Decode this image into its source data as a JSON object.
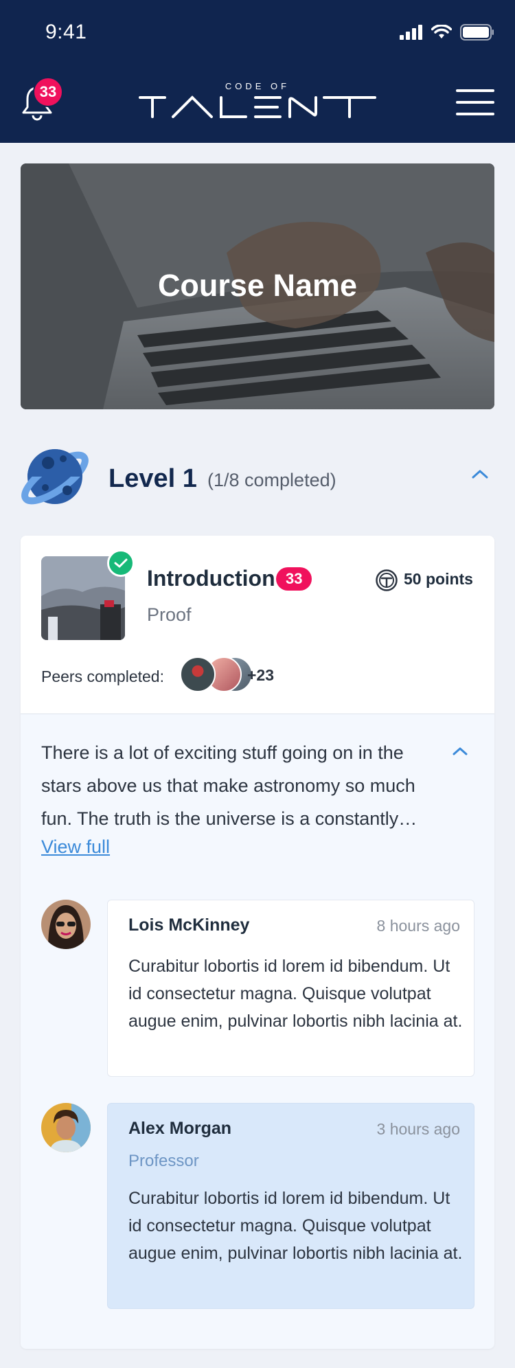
{
  "status_bar": {
    "time": "9:41"
  },
  "header": {
    "notification_count": "33",
    "logo_top": "CODE OF",
    "logo_main": "TALENT"
  },
  "hero": {
    "title": "Course Name"
  },
  "level": {
    "title": "Level 1",
    "progress": "(1/8 completed)"
  },
  "lesson": {
    "title": "Introduction",
    "badge": "33",
    "points": "50 points",
    "subtitle": "Proof",
    "peers_label": "Peers completed:",
    "peers_more": "+23",
    "description": "There is a lot of exciting stuff going on in the stars above us that make astronomy so much fun. The truth is the universe is a constantly…",
    "view_full": "View full"
  },
  "comments": [
    {
      "name": "Lois McKinney",
      "time": "8 hours ago",
      "role": "",
      "text": "Curabitur lobortis id lorem id bibendum. Ut id consectetur magna. Quisque volutpat augue enim, pulvinar lobortis nibh lacinia at."
    },
    {
      "name": "Alex Morgan",
      "time": "3 hours ago",
      "role": "Professor",
      "text": "Curabitur lobortis id lorem id bibendum. Ut id consectetur magna. Quisque volutpat augue enim, pulvinar lobortis nibh lacinia at."
    }
  ],
  "colors": {
    "header_bg": "#10254f",
    "badge": "#f0115c",
    "check": "#17b978",
    "link": "#3b8ad9",
    "professor_bg": "#d9e8fa"
  },
  "icons": {
    "notification": "bell-icon",
    "menu": "hamburger-menu-icon",
    "level": "planet-icon",
    "collapse": "chevron-up-icon",
    "completed": "check-icon",
    "points": "steering-wheel-icon"
  }
}
